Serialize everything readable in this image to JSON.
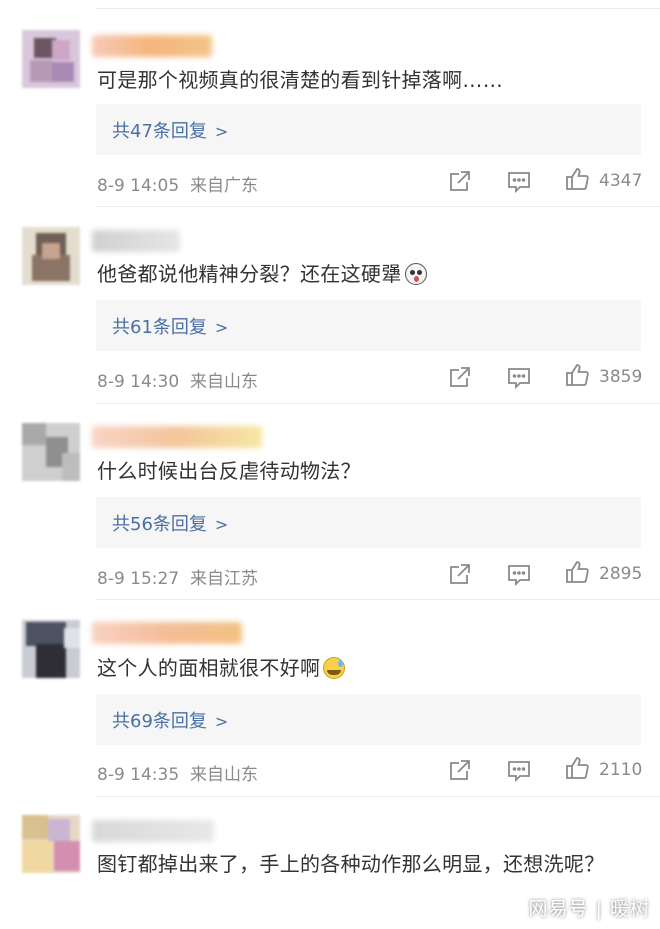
{
  "comments": [
    {
      "text": "可是那个视频真的很清楚的看到针掉落啊……",
      "replies_label": "共47条回复",
      "time": "8-9 14:05",
      "location": "来自广东",
      "likes": "4347"
    },
    {
      "text": "他爸都说他精神分裂？还在这硬犟",
      "replies_label": "共61条回复",
      "time": "8-9 14:30",
      "location": "来自山东",
      "likes": "3859",
      "emoji": "shocked-face"
    },
    {
      "text": "什么时候出台反虐待动物法？",
      "replies_label": "共56条回复",
      "time": "8-9 15:27",
      "location": "来自江苏",
      "likes": "2895"
    },
    {
      "text": "这个人的面相就很不好啊",
      "replies_label": "共69条回复",
      "time": "8-9 14:35",
      "location": "来自山东",
      "likes": "2110",
      "emoji": "sweat-smile-face"
    },
    {
      "text": "图钉都掉出来了，手上的各种动作那么明显，还想洗呢？"
    }
  ],
  "icons": {
    "share": "share-icon",
    "comment": "comment-icon",
    "like": "thumbs-up-icon",
    "chevron": "chevron-right-icon"
  },
  "watermark": "网易号 | 暖树",
  "colors": {
    "reply_link": "#4a6fa5",
    "meta": "#8a8a8a",
    "reply_bg": "#f6f6f6"
  }
}
